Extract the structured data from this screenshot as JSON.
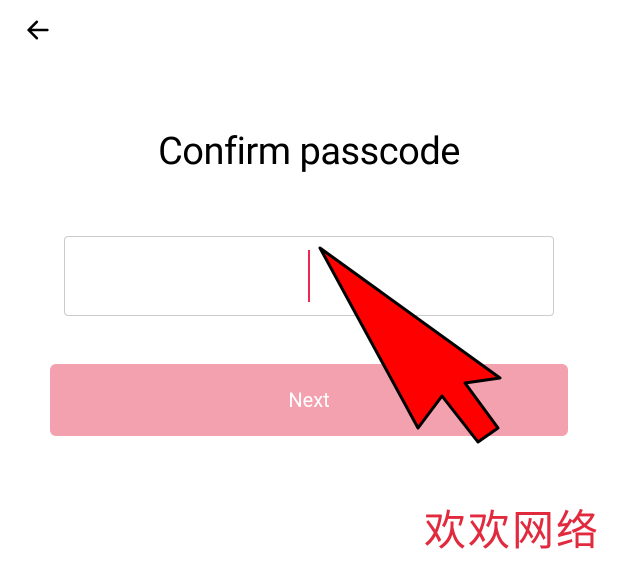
{
  "header": {
    "back_icon": "back"
  },
  "title": "Confirm passcode",
  "passcode": {
    "value": ""
  },
  "actions": {
    "next_label": "Next"
  },
  "watermark": "欢欢网络"
}
